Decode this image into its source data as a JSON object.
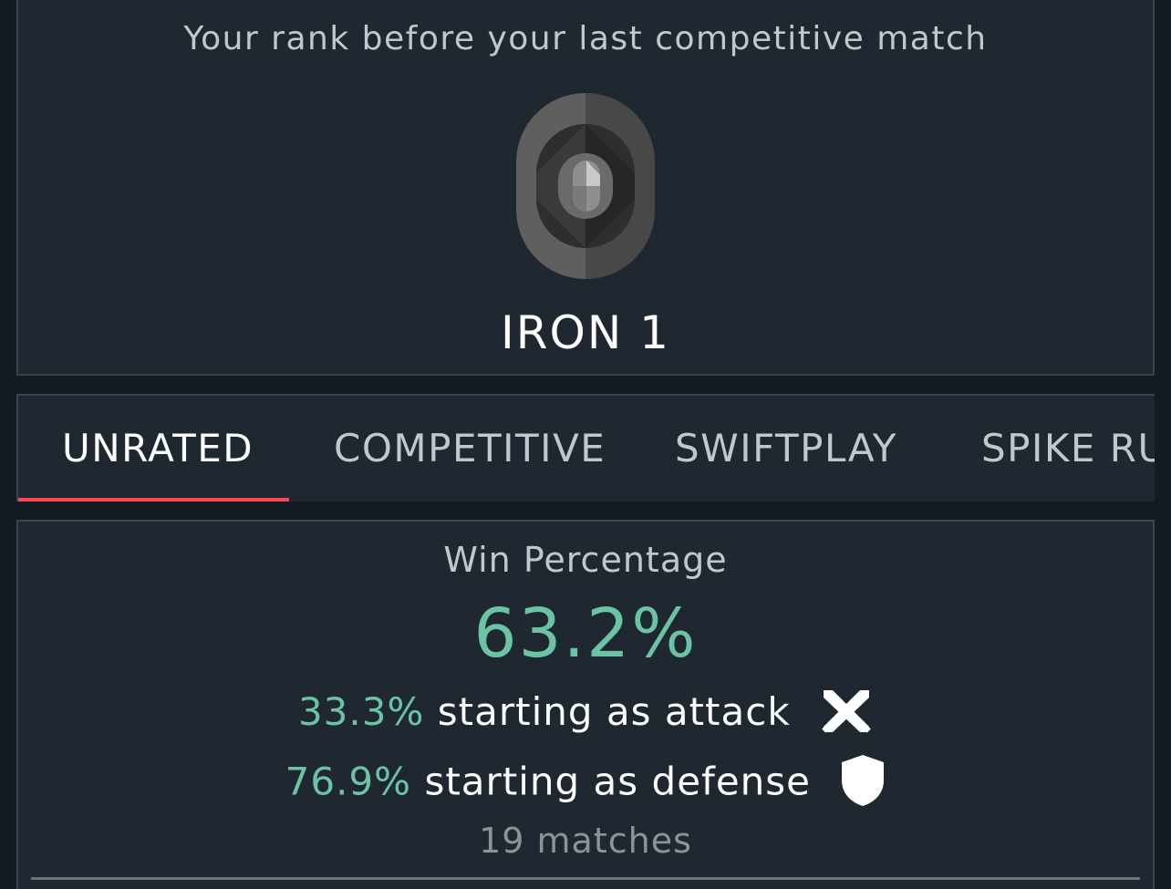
{
  "rank": {
    "caption": "Your rank before your last competitive match",
    "name": "IRON 1",
    "emblem_icon": "iron-rank-emblem-icon"
  },
  "tabs": [
    {
      "label": "UNRATED",
      "active": true
    },
    {
      "label": "COMPETITIVE",
      "active": false
    },
    {
      "label": "SWIFTPLAY",
      "active": false
    },
    {
      "label": "SPIKE RU",
      "active": false
    }
  ],
  "stats": {
    "label": "Win Percentage",
    "value": "63.2%",
    "attack": {
      "pct": "33.3%",
      "desc": "starting as attack",
      "icon": "crossed-swords-icon"
    },
    "defense": {
      "pct": "76.9%",
      "desc": "starting as defense",
      "icon": "shield-icon"
    },
    "matches": "19 matches"
  },
  "colors": {
    "background": "#121a22",
    "card": "#1f2831",
    "accent_red": "#ff4655",
    "accent_green": "#6cc3a4"
  }
}
